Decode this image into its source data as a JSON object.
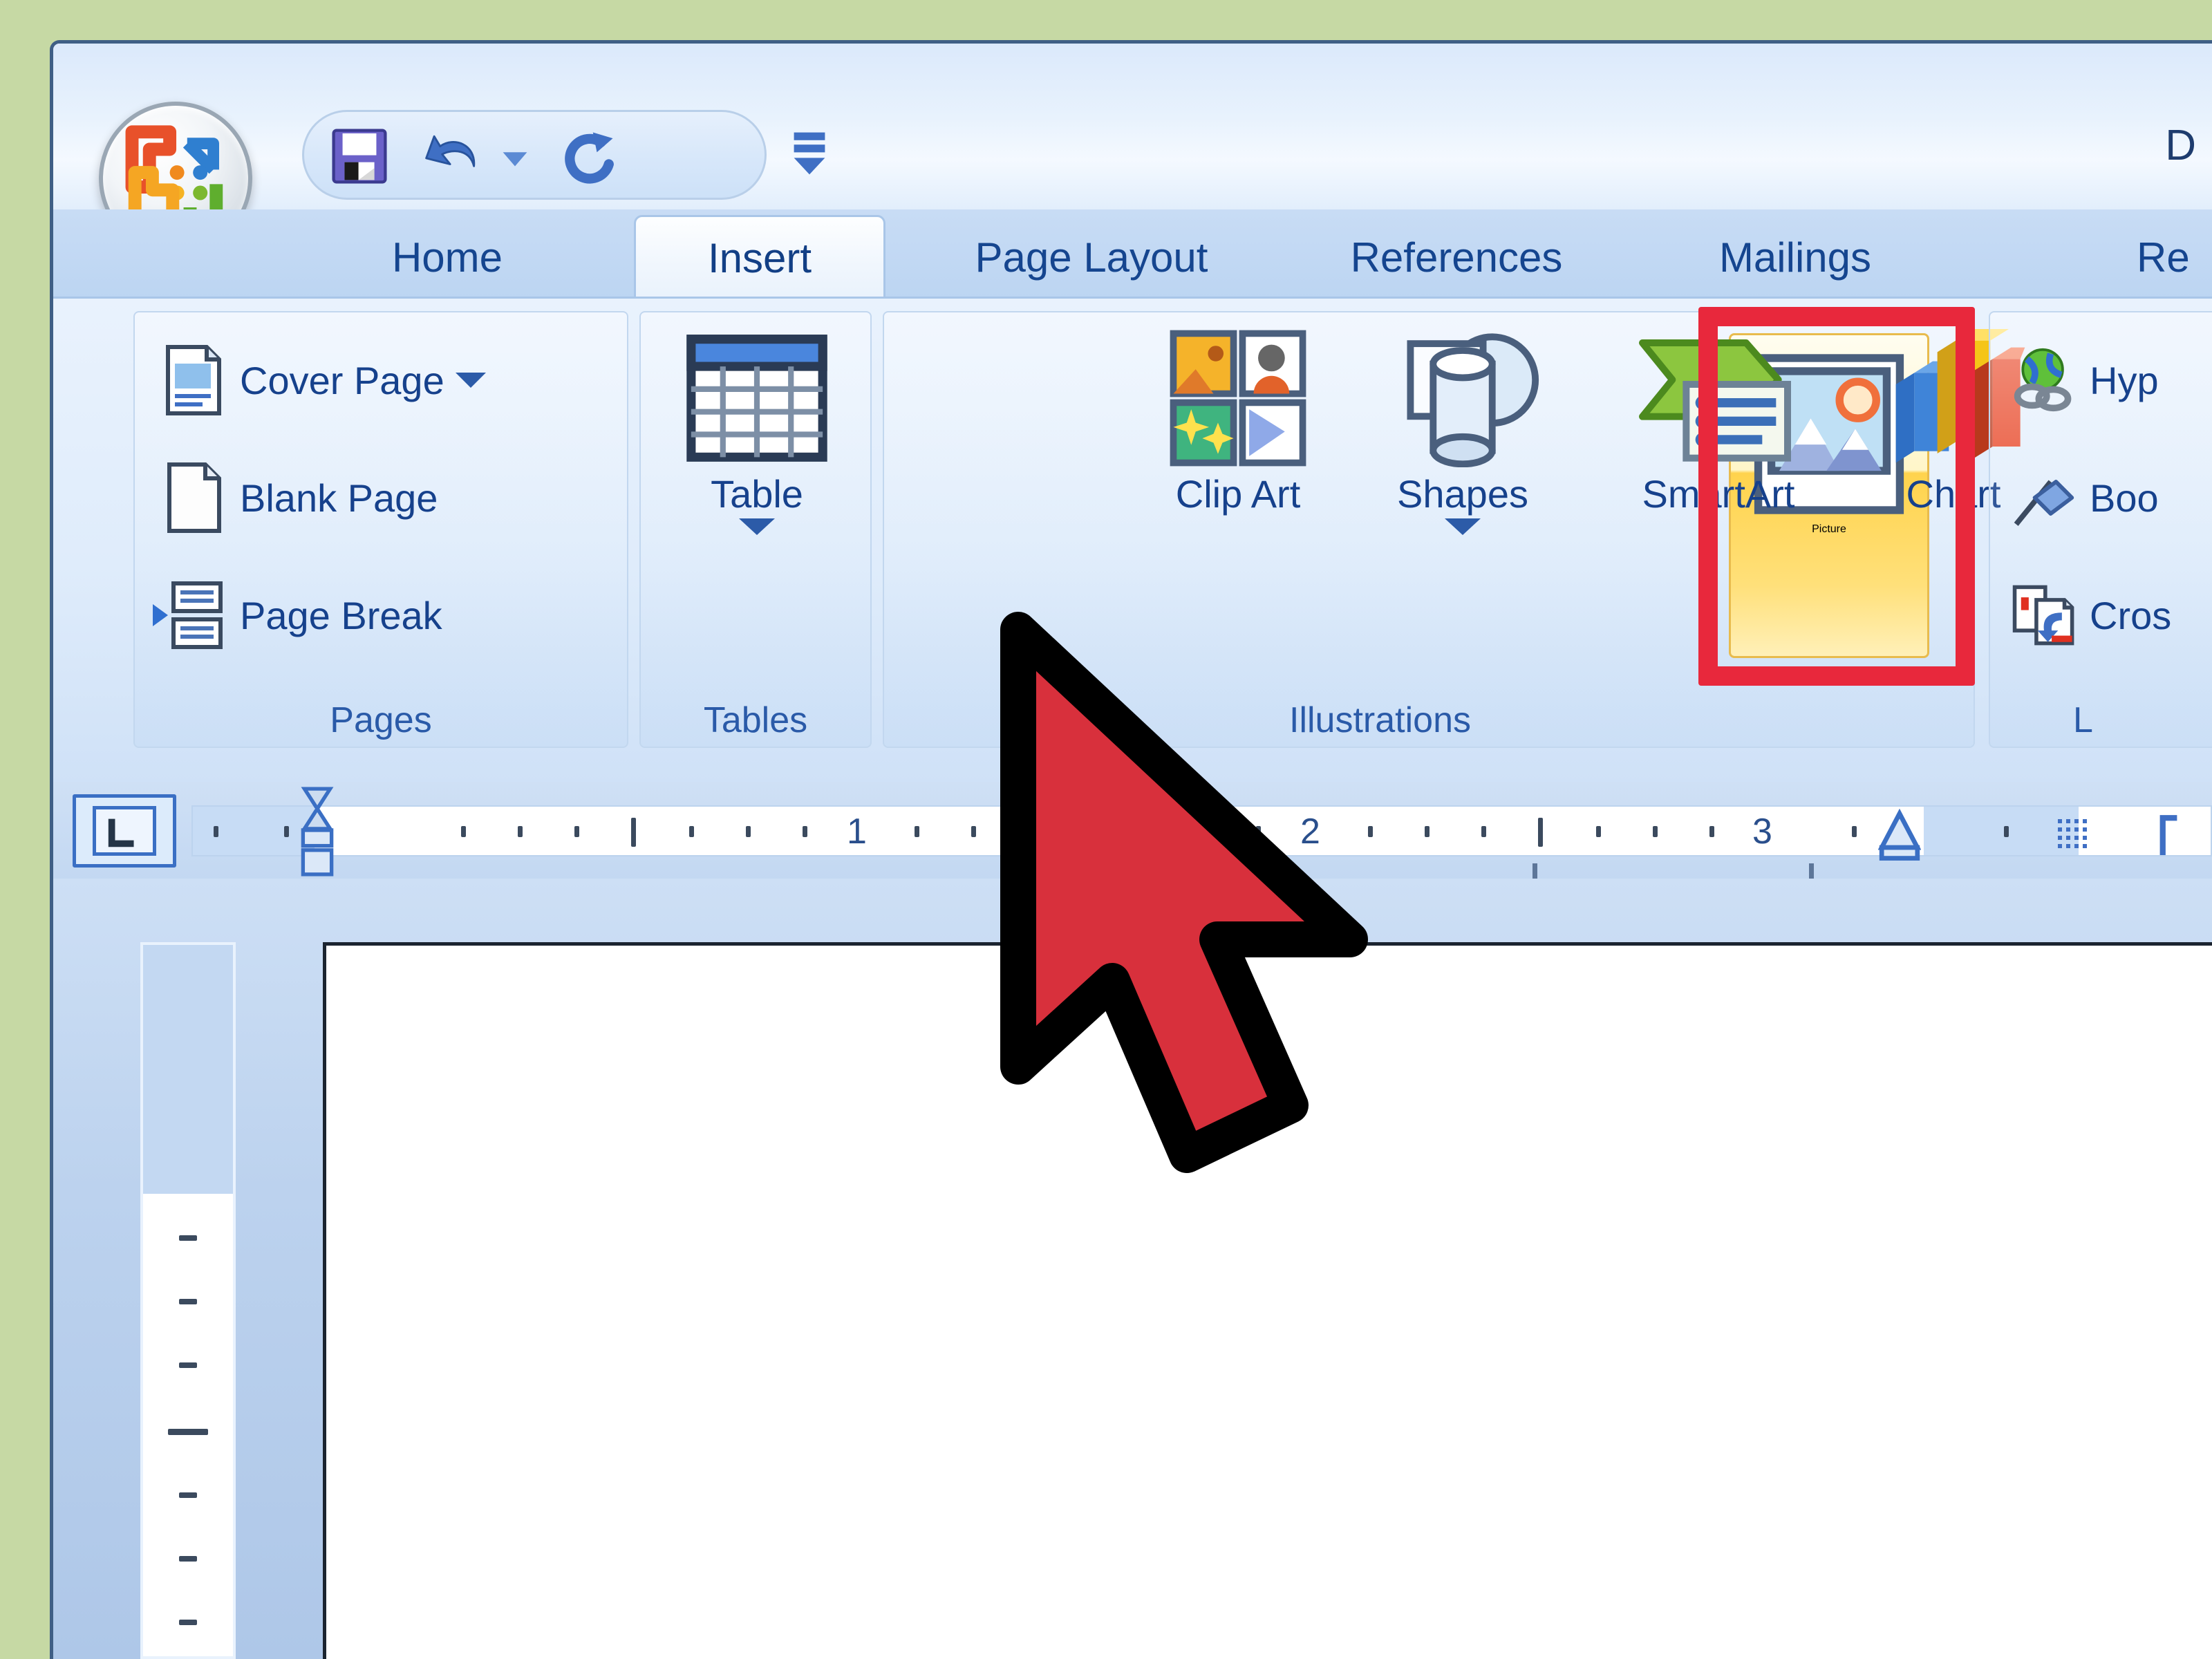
{
  "theme": {
    "background": "#c6d9a4",
    "window_border": "#3f5f85",
    "accent_blue": "#15458f",
    "highlight_red": "#e8283c",
    "cursor_red": "#d8303c",
    "hover_amber": "#ffd34d"
  },
  "titlebar": {
    "document_title": "D",
    "office_orb": "office-orb-button"
  },
  "quick_access_toolbar": {
    "items": [
      {
        "name": "save",
        "icon": "save-floppy-icon"
      },
      {
        "name": "undo",
        "icon": "undo-arrow-icon",
        "has_dropdown": true
      },
      {
        "name": "redo",
        "icon": "redo-arrow-icon"
      }
    ],
    "customize": {
      "name": "customize-quick-access-toolbar",
      "icon": "customize-qat-icon"
    }
  },
  "ribbon": {
    "tabs": [
      {
        "label": "Home",
        "active": false
      },
      {
        "label": "Insert",
        "active": true
      },
      {
        "label": "Page Layout",
        "active": false
      },
      {
        "label": "References",
        "active": false
      },
      {
        "label": "Mailings",
        "active": false
      },
      {
        "label": "Re",
        "active": false
      }
    ],
    "groups": [
      {
        "label": "Pages",
        "items": [
          {
            "label": "Cover Page",
            "icon": "cover-page-icon",
            "has_dropdown": true
          },
          {
            "label": "Blank Page",
            "icon": "blank-page-icon",
            "has_dropdown": false
          },
          {
            "label": "Page Break",
            "icon": "page-break-icon",
            "has_dropdown": false
          }
        ]
      },
      {
        "label": "Tables",
        "items": [
          {
            "label": "Table",
            "icon": "table-grid-icon",
            "has_dropdown": true
          }
        ]
      },
      {
        "label": "Illustrations",
        "items": [
          {
            "label": "Picture",
            "icon": "picture-photo-icon",
            "has_dropdown": false,
            "highlighted": true,
            "hovered": true
          },
          {
            "label": "Clip Art",
            "icon": "clip-art-icon",
            "has_dropdown": false
          },
          {
            "label": "Shapes",
            "icon": "shapes-icon",
            "has_dropdown": true
          },
          {
            "label": "SmartArt",
            "icon": "smartart-icon",
            "has_dropdown": false
          },
          {
            "label": "Chart",
            "icon": "chart-bars-icon",
            "has_dropdown": false
          }
        ]
      },
      {
        "label": "L",
        "items": [
          {
            "label": "Hyp",
            "icon": "hyperlink-globe-icon",
            "has_dropdown": false
          },
          {
            "label": "Boo",
            "icon": "bookmark-flag-icon",
            "has_dropdown": false
          },
          {
            "label": "Cros",
            "icon": "cross-reference-icon",
            "has_dropdown": false
          }
        ]
      }
    ]
  },
  "ruler": {
    "tab_stop_selector": "left-tab-stop",
    "tab_stop_glyph": "L",
    "numbers": [
      "1",
      "2",
      "3"
    ],
    "unit": "inches"
  },
  "document": {
    "page_state": "blank-page"
  },
  "annotation": {
    "cursor": "red-arrow-pointer",
    "target": "Picture"
  }
}
